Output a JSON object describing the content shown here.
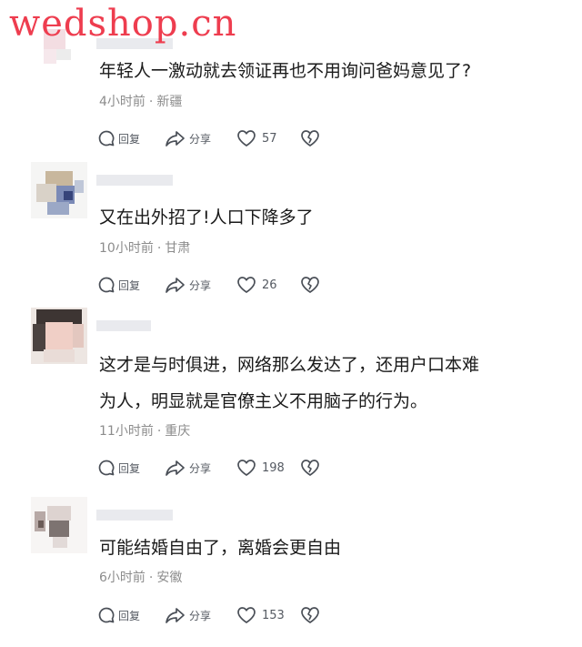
{
  "watermark": "wedshop.cn",
  "labels": {
    "reply": "回复",
    "share": "分享"
  },
  "icons": {
    "reply": "comment-bubble-icon",
    "share": "share-arrow-icon",
    "like": "heart-icon",
    "dislike": "broken-heart-icon"
  },
  "comments": [
    {
      "text": "年轻人一激动就去领证再也不用询问爸妈意见了?",
      "time": "4小时前",
      "location": "新疆",
      "likes": "57"
    },
    {
      "text": "又在出外招了!人口下降多了",
      "time": "10小时前",
      "location": "甘肃",
      "likes": "26"
    },
    {
      "text_line1": "这才是与时俱进，网络那么发达了，还用户口本难",
      "text_line2": "为人，明显就是官僚主义不用脑子的行为。",
      "time": "11小时前",
      "location": "重庆",
      "likes": "198"
    },
    {
      "text": "可能结婚自由了，离婚会更自由",
      "time": "6小时前",
      "location": "安徽",
      "likes": "153"
    }
  ]
}
